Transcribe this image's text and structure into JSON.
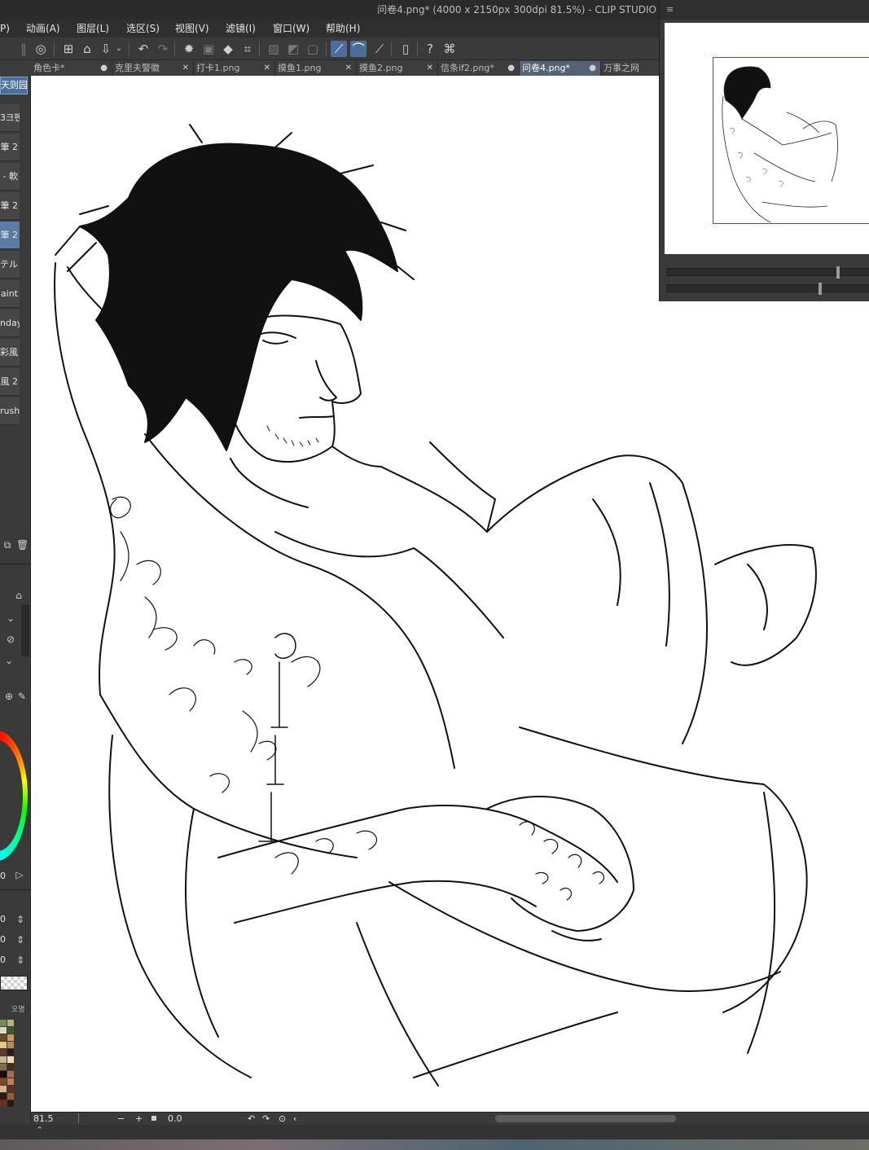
{
  "window": {
    "title": "问卷4.png* (4000 x 2150px 300dpi 81.5%)  - CLIP STUDIO"
  },
  "menu": [
    "P)",
    "动画(A)",
    "图层(L)",
    "选区(S)",
    "视图(V)",
    "滤镜(I)",
    "窗口(W)",
    "帮助(H)"
  ],
  "toolbar": {
    "icons": [
      "menu-grip-icon",
      "logo-icon",
      "new-canvas-icon",
      "open-file-icon",
      "export-icon",
      "undo-icon",
      "redo-icon",
      "loading-icon",
      "clear-layer-icon",
      "fill-icon",
      "transform-icon",
      "deselect-icon",
      "invert-selection-icon",
      "show-selection-icon",
      "snap-ruler-icon",
      "snap-special-ruler-icon",
      "snap-grid-icon",
      "mobile-icon",
      "help-icon",
      "settings-icon"
    ]
  },
  "tabs": [
    {
      "label": "角色卡*",
      "close": "●"
    },
    {
      "label": "克里夫警徽",
      "close": "✕"
    },
    {
      "label": "打卡1.png",
      "close": "✕"
    },
    {
      "label": "摸鱼1.png",
      "close": "✕"
    },
    {
      "label": "摸鱼2.png",
      "close": "✕"
    },
    {
      "label": "信条if2.png*",
      "close": "●"
    },
    {
      "label": "问卷4.png*",
      "close": "●",
      "active": true
    },
    {
      "label": "万事之网",
      "close": ""
    }
  ],
  "brush_panel": {
    "header": "天则园",
    "items": [
      "3크펜",
      "筆 2",
      "- 軟",
      "筆 2",
      "筆 2",
      "テル",
      "aint",
      "nday",
      "彩風",
      "風 2",
      "rush"
    ],
    "selected_index": 4
  },
  "color_panel": {
    "wheel_value": "0",
    "fields": [
      "0",
      "0",
      "0"
    ],
    "swatch_label": "오명"
  },
  "swatches": [
    "#7a8c4a",
    "#b7b37b",
    "#d9d9c9",
    "#3a5a2a",
    "#6b4a2a",
    "#c99a5a",
    "#e8c48a",
    "#b38a5a",
    "#5a3a2a",
    "#2a1a1a",
    "#d2b48c",
    "#f2dcb0",
    "#8a6a4a",
    "#4a2a1a",
    "#1a0a0a",
    "#a07050",
    "#7a4a2a",
    "#c08060",
    "#e0b090",
    "#603020",
    "#301810",
    "#9a5a3a",
    "#6a3020",
    "#2a1a10"
  ],
  "navigator": {
    "title": "≡"
  },
  "statusbar": {
    "zoom": "81.5",
    "angle": "0.0",
    "minus": "−",
    "plus": "+"
  },
  "accent": "#4d6d9a",
  "canvas_bg": "#ffffff"
}
